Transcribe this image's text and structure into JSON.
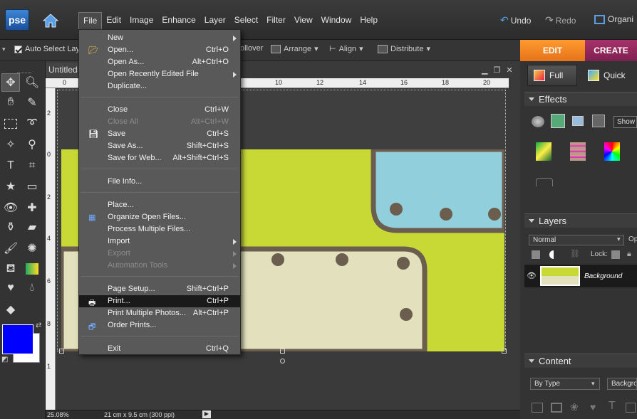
{
  "app": {
    "logo": "pse"
  },
  "menubar": {
    "items": [
      "File",
      "Edit",
      "Image",
      "Enhance",
      "Layer",
      "Select",
      "Filter",
      "View",
      "Window",
      "Help"
    ]
  },
  "toolbar_right": {
    "undo": "Undo",
    "redo": "Redo",
    "organize": "Organi"
  },
  "options": {
    "auto_select": "Auto Select Layer",
    "rollover": "ollover",
    "arrange": "Arrange",
    "align": "Align",
    "distribute": "Distribute"
  },
  "modes": {
    "edit": "EDIT",
    "create": "CREATE"
  },
  "document": {
    "tab": "Untitled",
    "zoom": "25.08%",
    "size": "21 cm x 9.5 cm (300 ppi)"
  },
  "ruler": {
    "top": [
      "0",
      "10",
      "12",
      "14",
      "16",
      "18",
      "20"
    ],
    "left": [
      "2",
      "0",
      "2",
      "4",
      "6",
      "8",
      "1"
    ]
  },
  "panels": {
    "full": "Full",
    "quick": "Quick",
    "effects": "Effects",
    "show": "Show",
    "layers": "Layers",
    "blend": "Normal",
    "lock": "Lock:",
    "opacity": "Op",
    "layer_name": "Background",
    "content": "Content",
    "by_type": "By Type",
    "background_sel": "Backgrou"
  },
  "colors": {
    "foreground": "#0000ff",
    "background": "#ffffff",
    "canvas_green": "#c8d935",
    "canvas_blue": "#92cfdd",
    "canvas_cream": "#e2e0bd",
    "stroke": "#6b5e4f",
    "edit_orange": "#f7871f",
    "create_magenta": "#96296a"
  },
  "file_menu": {
    "items": [
      {
        "label": "New",
        "shortcut": "",
        "submenu": true,
        "disabled": false
      },
      {
        "label": "Open...",
        "shortcut": "Ctrl+O",
        "icon": "folder-open-icon"
      },
      {
        "label": "Open As...",
        "shortcut": "Alt+Ctrl+O"
      },
      {
        "label": "Open Recently Edited File",
        "shortcut": "",
        "submenu": true
      },
      {
        "label": "Duplicate...",
        "shortcut": ""
      },
      {
        "sep": true
      },
      {
        "label": "Close",
        "shortcut": "Ctrl+W"
      },
      {
        "label": "Close All",
        "shortcut": "Alt+Ctrl+W",
        "disabled": true
      },
      {
        "label": "Save",
        "shortcut": "Ctrl+S",
        "icon": "floppy-disk-icon"
      },
      {
        "label": "Save As...",
        "shortcut": "Shift+Ctrl+S"
      },
      {
        "label": "Save for Web...",
        "shortcut": "Alt+Shift+Ctrl+S"
      },
      {
        "sep": true
      },
      {
        "label": "File Info...",
        "shortcut": ""
      },
      {
        "sep": true
      },
      {
        "label": "Place...",
        "shortcut": ""
      },
      {
        "label": "Organize Open Files...",
        "shortcut": "",
        "icon": "grid-icon"
      },
      {
        "label": "Process Multiple Files...",
        "shortcut": ""
      },
      {
        "label": "Import",
        "shortcut": "",
        "submenu": true
      },
      {
        "label": "Export",
        "shortcut": "",
        "submenu": true,
        "disabled": true
      },
      {
        "label": "Automation Tools",
        "shortcut": "",
        "submenu": true,
        "disabled": true
      },
      {
        "sep": true
      },
      {
        "label": "Page Setup...",
        "shortcut": "Shift+Ctrl+P"
      },
      {
        "label": "Print...",
        "shortcut": "Ctrl+P",
        "icon": "printer-icon",
        "highlighted": true
      },
      {
        "label": "Print Multiple Photos...",
        "shortcut": "Alt+Ctrl+P"
      },
      {
        "label": "Order Prints...",
        "shortcut": "",
        "icon": "order-prints-icon"
      },
      {
        "sep": true
      },
      {
        "label": "Exit",
        "shortcut": "Ctrl+Q"
      }
    ]
  }
}
